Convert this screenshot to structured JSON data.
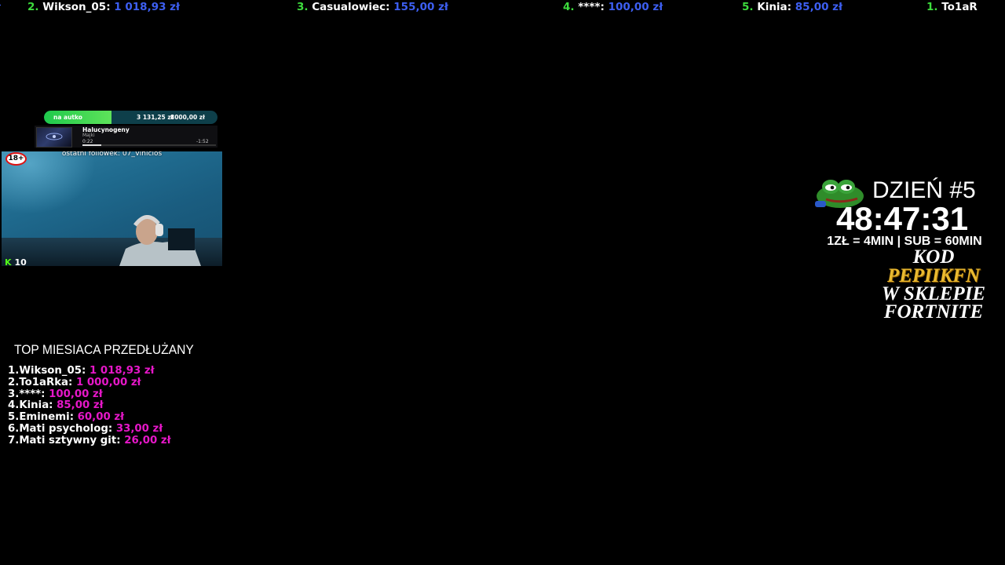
{
  "ticker": [
    {
      "rank": "2.",
      "name": "Wikson_05:",
      "amount": "1 018,93 zł"
    },
    {
      "rank": "3.",
      "name": "Casualowiec:",
      "amount": "155,00 zł"
    },
    {
      "rank": "4.",
      "name": "****:",
      "amount": "100,00 zł"
    },
    {
      "rank": "5.",
      "name": "Kinia:",
      "amount": "85,00 zł"
    },
    {
      "rank": "1.",
      "name": "To1aR",
      "amount": ""
    }
  ],
  "goal": {
    "label": "na autko",
    "current": "3 131,25 zł",
    "target": "8000,00 zł",
    "progress": 0.39
  },
  "now_playing": {
    "title": "Halucynogeny",
    "artist": "Majki",
    "elapsed": "0:22",
    "remaining": "-1:52",
    "progress": 0.14
  },
  "cam": {
    "last_follower": "ostatni followek: 07_Vinicios",
    "age_badge": "18+",
    "kick_icon": "kick-logo-icon",
    "kick_glyph": "K",
    "viewer_count": "10"
  },
  "subathon": {
    "day": "DZIEŃ #5",
    "timer": "48:47:31",
    "rates": "1ZŁ = 4MIN | SUB = 60MIN",
    "promo_line1": "KOD",
    "promo_code": "PEPIIKFN",
    "promo_line3": "W SKLEPIE",
    "promo_line4": "FORTNITE"
  },
  "top_month": {
    "title": "TOP MIESIACA PRZEDŁUŻANY",
    "items": [
      {
        "rank": "1.",
        "name": "Wikson_05:",
        "amount": "1 018,93 zł"
      },
      {
        "rank": "2.",
        "name": "To1aRka:",
        "amount": "1 000,00 zł"
      },
      {
        "rank": "3.",
        "name": "****:",
        "amount": "100,00 zł"
      },
      {
        "rank": "4.",
        "name": "Kinia:",
        "amount": "85,00 zł"
      },
      {
        "rank": "5.",
        "name": "Eminemi:",
        "amount": "60,00 zł"
      },
      {
        "rank": "6.",
        "name": "Mati psycholog:",
        "amount": "33,00 zł"
      },
      {
        "rank": "7.",
        "name": "Mati sztywny git:",
        "amount": "26,00 zł"
      }
    ]
  },
  "colors": {
    "ticker_rank": "#3ddc3d",
    "ticker_amount": "#3d5ff2",
    "top_amount": "#e617c8",
    "goal_fill": "#1fc94c",
    "promo_code": "#e9b930",
    "kick_green": "#53fc18"
  }
}
